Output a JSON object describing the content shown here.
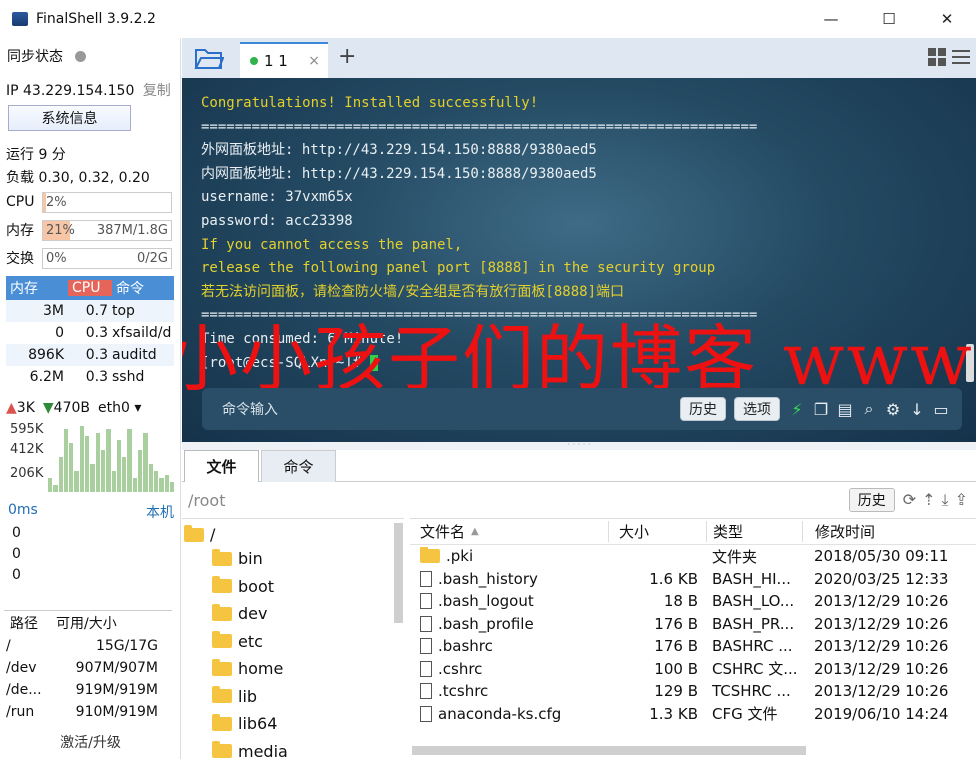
{
  "window": {
    "title": "FinalShell 3.9.2.2",
    "controls": [
      "—",
      "☐",
      "✕"
    ]
  },
  "left": {
    "sync_label": "同步状态",
    "ip_label": "IP 43.229.154.150",
    "copy_label": "复制",
    "sysinfo_button": "系统信息",
    "uptime": "运行 9 分",
    "load": "负载 0.30, 0.32, 0.20",
    "cpu": {
      "label": "CPU",
      "percent_text": "2%",
      "detail": "",
      "fill": 0.02
    },
    "mem": {
      "label": "内存",
      "percent_text": "21%",
      "detail": "387M/1.8G",
      "fill": 0.21
    },
    "swap": {
      "label": "交换",
      "percent_text": "0%",
      "detail": "0/2G",
      "fill": 0
    },
    "process_headers": [
      "内存",
      "CPU",
      "命令"
    ],
    "processes": [
      {
        "mem": "3M",
        "cpu": "0.7",
        "cmd": "top"
      },
      {
        "mem": "0",
        "cpu": "0.3",
        "cmd": "xfsaild/d"
      },
      {
        "mem": "896K",
        "cpu": "0.3",
        "cmd": "auditd"
      },
      {
        "mem": "6.2M",
        "cpu": "0.3",
        "cmd": "sshd"
      }
    ],
    "net": {
      "up": "3K",
      "down": "470B",
      "iface": "eth0",
      "ticks": [
        "595K",
        "412K",
        "206K"
      ]
    },
    "net_bars": [
      0.2,
      0.1,
      0.5,
      0.9,
      0.7,
      0.3,
      0.95,
      0.8,
      0.4,
      0.85,
      0.6,
      0.9,
      0.3,
      0.75,
      0.5,
      0.9,
      0.2,
      0.6,
      0.85,
      0.4,
      0.3,
      0.2,
      0.25,
      0.15
    ],
    "ping": {
      "latency": "0ms",
      "host": "本机",
      "values": [
        "0",
        "0",
        "0"
      ]
    },
    "disk_headers": [
      "路径",
      "可用/大小"
    ],
    "disks": [
      {
        "path": "/",
        "size": "15G/17G"
      },
      {
        "path": "/dev",
        "size": "907M/907M"
      },
      {
        "path": "/de...",
        "size": "919M/919M"
      },
      {
        "path": "/run",
        "size": "910M/919M"
      }
    ],
    "activate": "激活/升级"
  },
  "tabs": {
    "session_label": "1 1",
    "close": "×",
    "add": "+"
  },
  "terminal": {
    "lines": [
      {
        "text": "Congratulations! Installed successfully!",
        "color": "yellow"
      },
      {
        "text": "==================================================================",
        "color": "white"
      },
      {
        "text": "外网面板地址: http://43.229.154.150:8888/9380aed5",
        "color": "white"
      },
      {
        "text": "内网面板地址: http://43.229.154.150:8888/9380aed5",
        "color": "white"
      },
      {
        "text": "username: 37vxm65x",
        "color": "white"
      },
      {
        "text": "password: acc23398",
        "color": "white"
      },
      {
        "text": "If you cannot access the panel,",
        "color": "yellow"
      },
      {
        "text": "release the following panel port [8888] in the security group",
        "color": "yellow"
      },
      {
        "text": "若无法访问面板，请检查防火墙/安全组是否有放行面板[8888]端口",
        "color": "yellow"
      },
      {
        "text": "==================================================================",
        "color": "white"
      },
      {
        "text": "Time consumed: 6 Minute!",
        "color": "white"
      },
      {
        "text": "[root@ecs-SQLXn ~]# ",
        "color": "white"
      }
    ],
    "watermark": "小小孩子们的博客 www",
    "command_placeholder": "命令输入",
    "history_button": "历史",
    "options_button": "选项"
  },
  "files": {
    "tab_files": "文件",
    "tab_commands": "命令",
    "path": "/root",
    "history_button": "历史",
    "tree_root": "/",
    "tree": [
      "bin",
      "boot",
      "dev",
      "etc",
      "home",
      "lib",
      "lib64",
      "media"
    ],
    "headers": {
      "name": "文件名",
      "size": "大小",
      "type": "类型",
      "time": "修改时间"
    },
    "rows": [
      {
        "name": ".pki",
        "size": "",
        "type": "文件夹",
        "time": "2018/05/30 09:11",
        "folder": true
      },
      {
        "name": ".bash_history",
        "size": "1.6 KB",
        "type": "BASH_HI...",
        "time": "2020/03/25 12:33",
        "folder": false
      },
      {
        "name": ".bash_logout",
        "size": "18 B",
        "type": "BASH_LO...",
        "time": "2013/12/29 10:26",
        "folder": false
      },
      {
        "name": ".bash_profile",
        "size": "176 B",
        "type": "BASH_PR...",
        "time": "2013/12/29 10:26",
        "folder": false
      },
      {
        "name": ".bashrc",
        "size": "176 B",
        "type": "BASHRC ...",
        "time": "2013/12/29 10:26",
        "folder": false
      },
      {
        "name": ".cshrc",
        "size": "100 B",
        "type": "CSHRC 文...",
        "time": "2013/12/29 10:26",
        "folder": false
      },
      {
        "name": ".tcshrc",
        "size": "129 B",
        "type": "TCSHRC ...",
        "time": "2013/12/29 10:26",
        "folder": false
      },
      {
        "name": "anaconda-ks.cfg",
        "size": "1.3 KB",
        "type": "CFG 文件",
        "time": "2019/06/10 14:24",
        "folder": false
      }
    ]
  }
}
